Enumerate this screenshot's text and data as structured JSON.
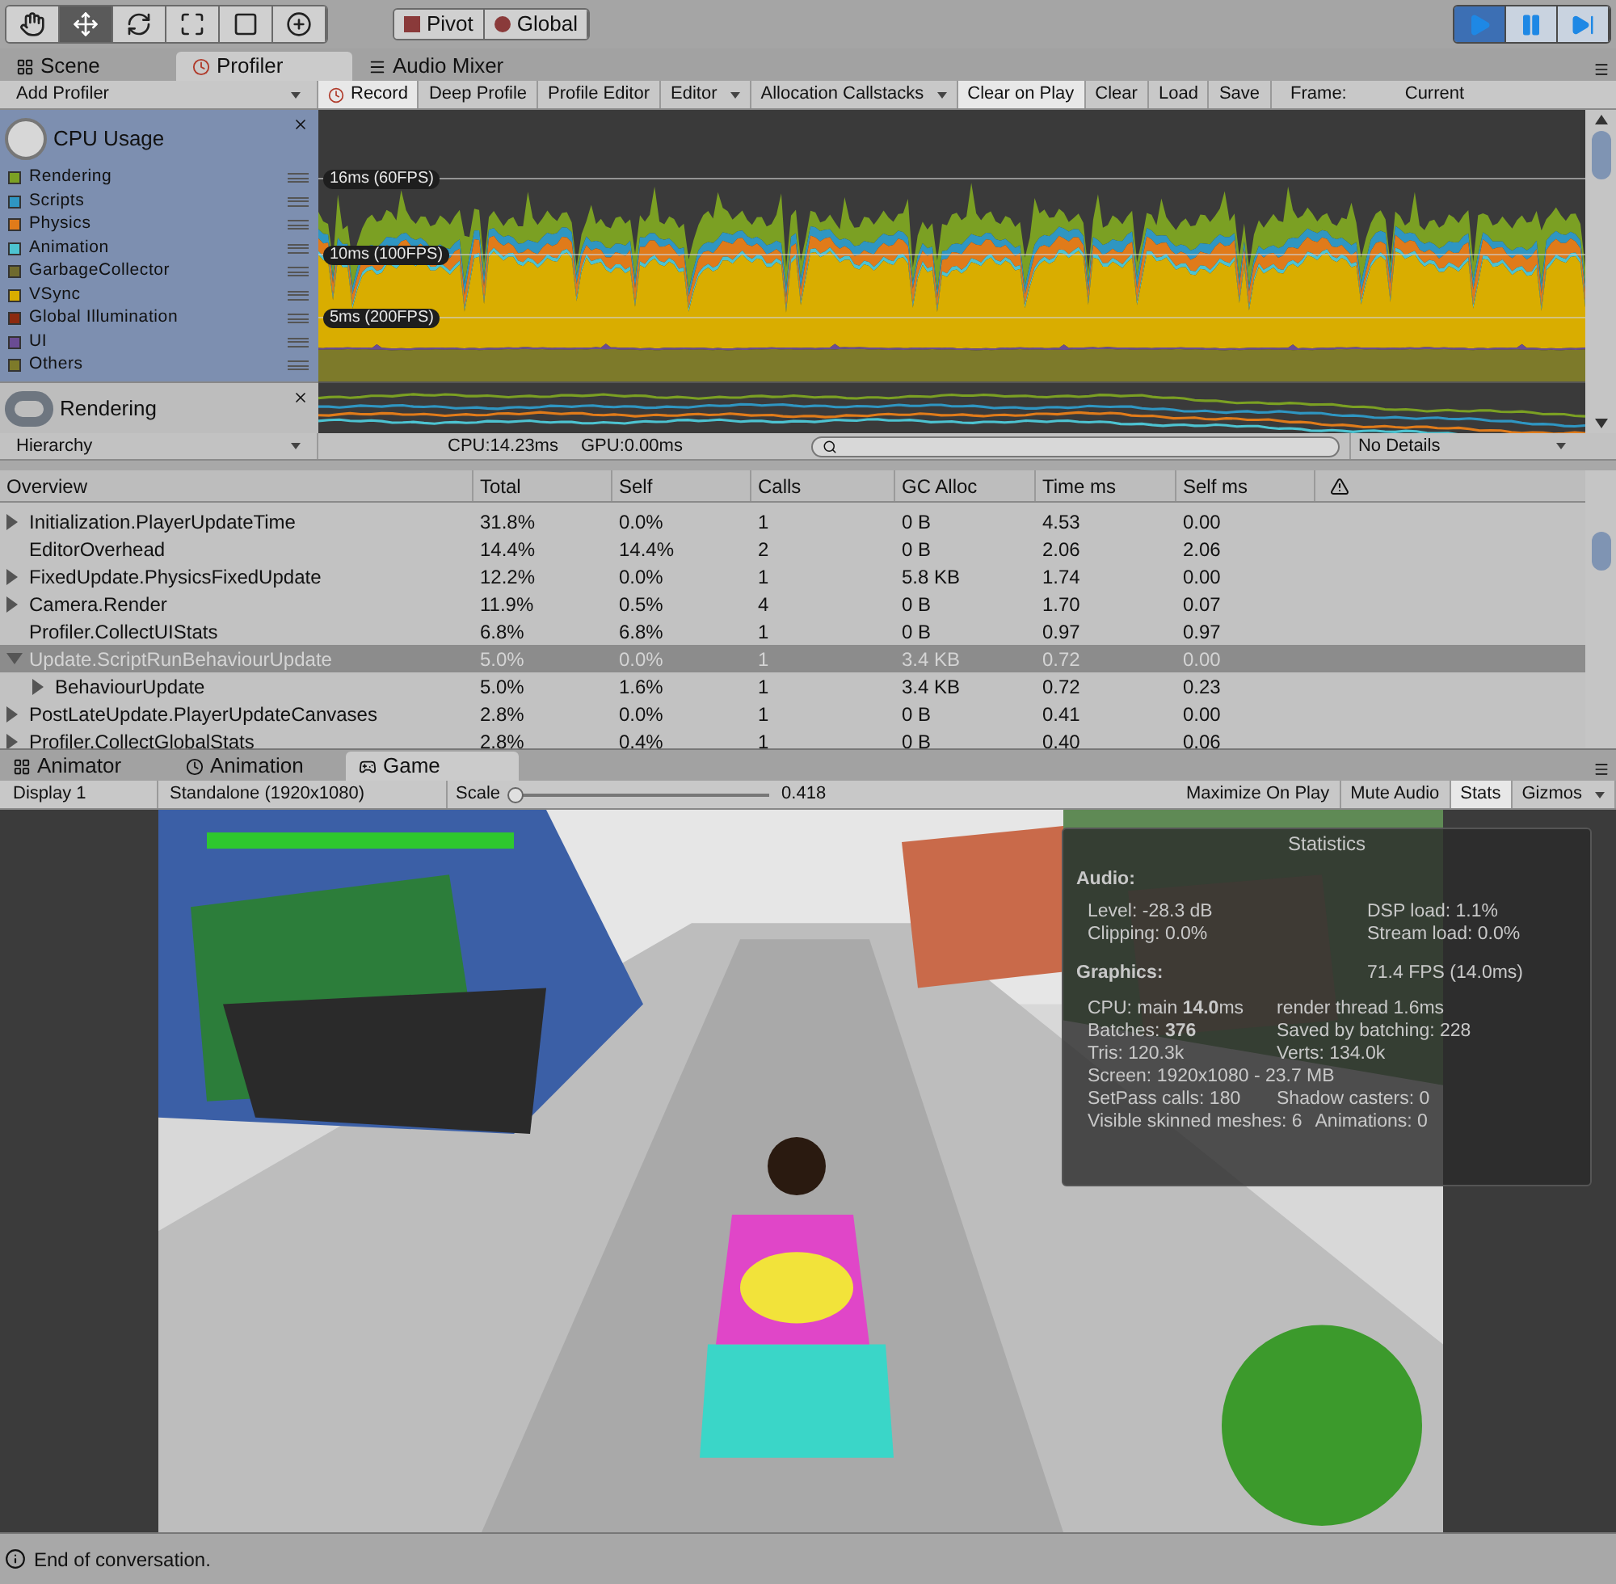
{
  "toolbar": {
    "tools": [
      {
        "selected": false
      },
      {
        "selected": true
      },
      {
        "selected": false
      },
      {
        "selected": false
      },
      {
        "selected": false
      },
      {
        "selected": false
      }
    ],
    "handle_buttons": [
      {
        "label": "Pivot"
      },
      {
        "label": "Global"
      }
    ],
    "playback": [
      {
        "kind": "play",
        "selected": true
      },
      {
        "kind": "pause",
        "selected": false
      },
      {
        "kind": "step",
        "selected": false
      }
    ]
  },
  "top_tabs": [
    {
      "label": "Scene",
      "selected": false
    },
    {
      "label": "Profiler",
      "selected": true
    },
    {
      "label": "Audio Mixer",
      "selected": false
    }
  ],
  "profiler_toolbar": {
    "add_profiler": "Add Profiler",
    "buttons": [
      {
        "label": "Record",
        "kind": "toggle",
        "selected": true
      },
      {
        "label": "Deep Profile",
        "kind": "toggle",
        "selected": false
      },
      {
        "label": "Profile Editor",
        "kind": "toggle",
        "selected": false
      },
      {
        "label": "Editor",
        "kind": "dropdown",
        "selected": false
      },
      {
        "label": "Allocation Callstacks",
        "kind": "dropdown",
        "selected": false
      },
      {
        "label": "Clear on Play",
        "kind": "toggle",
        "selected": true
      },
      {
        "label": "Clear",
        "kind": "toggle",
        "selected": false
      },
      {
        "label": "Load",
        "kind": "toggle",
        "selected": false
      },
      {
        "label": "Save",
        "kind": "toggle",
        "selected": false
      }
    ],
    "frame_label": "Frame:",
    "frame_value": "Current"
  },
  "modules": [
    {
      "title": "CPU Usage",
      "legend": [
        {
          "name": "Rendering",
          "color": "#7ba023"
        },
        {
          "name": "Scripts",
          "color": "#2f96c2"
        },
        {
          "name": "Physics",
          "color": "#e07b1a"
        },
        {
          "name": "Animation",
          "color": "#4dc3d1"
        },
        {
          "name": "GarbageCollector",
          "color": "#6f6a2e"
        },
        {
          "name": "VSync",
          "color": "#d9ad00"
        },
        {
          "name": "Global Illumination",
          "color": "#8c2a10"
        },
        {
          "name": "UI",
          "color": "#6a4c93"
        },
        {
          "name": "Others",
          "color": "#7d7a2a"
        }
      ],
      "guides": [
        "16ms (60FPS)",
        "10ms (100FPS)",
        "5ms (200FPS)"
      ]
    },
    {
      "title": "Rendering"
    }
  ],
  "details_bar": {
    "view": "Hierarchy",
    "cpu": "CPU:14.23ms",
    "gpu": "GPU:0.00ms",
    "detail": "No Details"
  },
  "table": {
    "columns": [
      "Overview",
      "Total",
      "Self",
      "Calls",
      "GC Alloc",
      "Time ms",
      "Self ms"
    ],
    "rows": [
      {
        "kind": "group",
        "expanded": false,
        "selected": false,
        "cells": [
          "Initialization.PlayerUpdateTime",
          "31.8%",
          "0.0%",
          "1",
          "0 B",
          "4.53",
          "0.00"
        ]
      },
      {
        "kind": "leaf",
        "selected": false,
        "cells": [
          "EditorOverhead",
          "14.4%",
          "14.4%",
          "2",
          "0 B",
          "2.06",
          "2.06"
        ]
      },
      {
        "kind": "group",
        "expanded": false,
        "selected": false,
        "cells": [
          "FixedUpdate.PhysicsFixedUpdate",
          "12.2%",
          "0.0%",
          "1",
          "5.8 KB",
          "1.74",
          "0.00"
        ]
      },
      {
        "kind": "group",
        "expanded": false,
        "selected": false,
        "cells": [
          "Camera.Render",
          "11.9%",
          "0.5%",
          "4",
          "0 B",
          "1.70",
          "0.07"
        ]
      },
      {
        "kind": "leaf",
        "selected": false,
        "cells": [
          "Profiler.CollectUIStats",
          "6.8%",
          "6.8%",
          "1",
          "0 B",
          "0.97",
          "0.97"
        ]
      },
      {
        "kind": "group",
        "expanded": true,
        "selected": true,
        "cells": [
          "Update.ScriptRunBehaviourUpdate",
          "5.0%",
          "0.0%",
          "1",
          "3.4 KB",
          "0.72",
          "0.00"
        ],
        "children": [
          {
            "kind": "group",
            "expanded": false,
            "selected": false,
            "cells": [
              "BehaviourUpdate",
              "5.0%",
              "1.6%",
              "1",
              "3.4 KB",
              "0.72",
              "0.23"
            ]
          }
        ]
      },
      {
        "kind": "group",
        "expanded": false,
        "selected": false,
        "cells": [
          "PostLateUpdate.PlayerUpdateCanvases",
          "2.8%",
          "0.0%",
          "1",
          "0 B",
          "0.41",
          "0.00"
        ]
      },
      {
        "kind": "group",
        "expanded": false,
        "selected": false,
        "cells": [
          "Profiler.CollectGlobalStats",
          "2.8%",
          "0.4%",
          "1",
          "0 B",
          "0.40",
          "0.06"
        ]
      }
    ]
  },
  "bottom_tabs": [
    {
      "label": "Animator",
      "selected": false
    },
    {
      "label": "Animation",
      "selected": false
    },
    {
      "label": "Game",
      "selected": true
    }
  ],
  "game_toolbar": {
    "display": "Display 1",
    "resolution": "Standalone (1920x1080)",
    "scale_label": "Scale",
    "scale": {
      "level": 0.02
    },
    "scale_value": "0.418",
    "buttons": [
      {
        "label": "Maximize On Play",
        "selected": false
      },
      {
        "label": "Mute Audio",
        "selected": false
      },
      {
        "label": "Stats",
        "selected": true
      },
      {
        "label": "Gizmos",
        "selected": false
      }
    ]
  },
  "statistics": {
    "title": "Statistics",
    "audio_heading": "Audio:",
    "audio": [
      [
        "Level: -28.3 dB",
        "DSP load: 1.1%"
      ],
      [
        "Clipping: 0.0%",
        "Stream load: 0.0%"
      ]
    ],
    "graphics_heading": "Graphics:",
    "fps": "71.4 FPS (14.0ms)",
    "graphics": [
      [
        "CPU: main **14.0**ms",
        "render thread 1.6ms"
      ],
      [
        "Batches: **376**",
        "Saved by batching: 228"
      ],
      [
        "Tris: 120.3k",
        "Verts: 134.0k"
      ],
      [
        "Screen: 1920x1080 - 23.7 MB"
      ],
      [
        "SetPass calls: 180",
        "Shadow casters: 0"
      ],
      [
        "Visible skinned meshes: 6",
        "Animations: 0"
      ]
    ]
  },
  "status_bar": {
    "message": "End of conversation."
  }
}
